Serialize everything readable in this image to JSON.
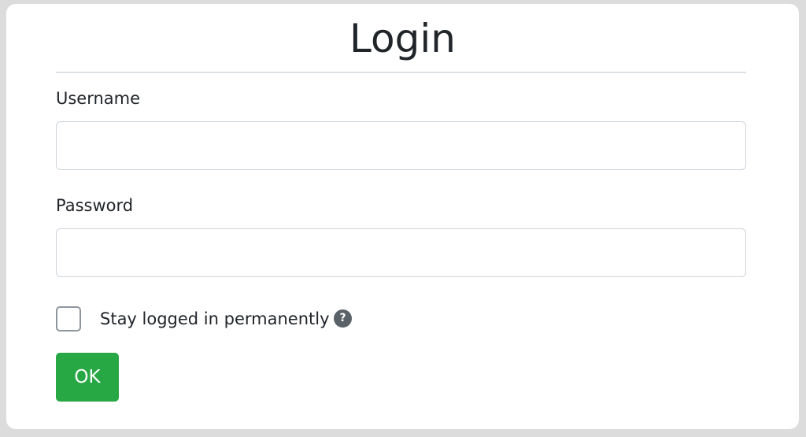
{
  "form": {
    "title": "Login",
    "username_label": "Username",
    "username_value": "",
    "password_label": "Password",
    "password_value": "",
    "stay_logged_in_label": "Stay logged in permanently",
    "stay_logged_in_checked": false,
    "help_icon_glyph": "?",
    "submit_label": "OK"
  },
  "icons": {
    "help": "question-circle-icon"
  },
  "colors": {
    "submit_button": "#28a745",
    "help_icon": "#5a6268",
    "divider": "#dee2e6",
    "input_border": "#ced4da"
  }
}
